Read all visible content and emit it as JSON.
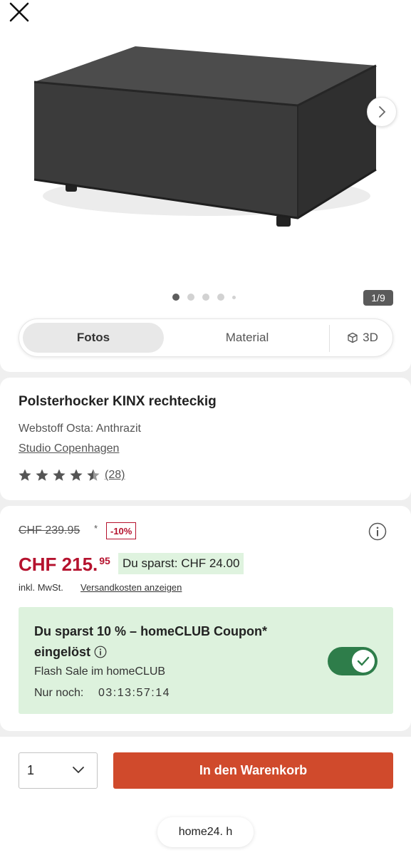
{
  "gallery": {
    "image_alt": "Polsterhocker KINX rechteckig, Anthrazit",
    "counter": "1/9",
    "tabs": {
      "fotos": "Fotos",
      "material": "Material",
      "view3d": "3D"
    }
  },
  "product": {
    "title": "Polsterhocker KINX rechteckig",
    "variant": "Webstoff Osta: Anthrazit",
    "brand": "Studio Copenhagen",
    "rating_count": "(28)",
    "rating_value": 4.5,
    "rating_max": 5
  },
  "price": {
    "old": "CHF 239.95",
    "old_mark": "*",
    "discount": "-10%",
    "current_main": "CHF 215.",
    "current_cents": "95",
    "savings": "Du sparst: CHF 24.00",
    "tax_note": "inkl. MwSt.",
    "shipping_link": "Versandkosten anzeigen"
  },
  "coupon": {
    "title": "Du sparst 10 % – homeCLUB Coupon* eingelöst",
    "flash_sale": "Flash Sale im homeCLUB",
    "countdown_label": "Nur noch:",
    "countdown": "03:13:57:14",
    "toggle_on": true
  },
  "cart": {
    "quantity": "1",
    "add_button": "In den Warenkorb"
  },
  "browser": {
    "url": "home24.  h"
  },
  "colors": {
    "price_red": "#b5122e",
    "cta_orange": "#d04a2c",
    "coupon_green_bg": "#ddf2dd",
    "toggle_green": "#2e7d4a"
  }
}
